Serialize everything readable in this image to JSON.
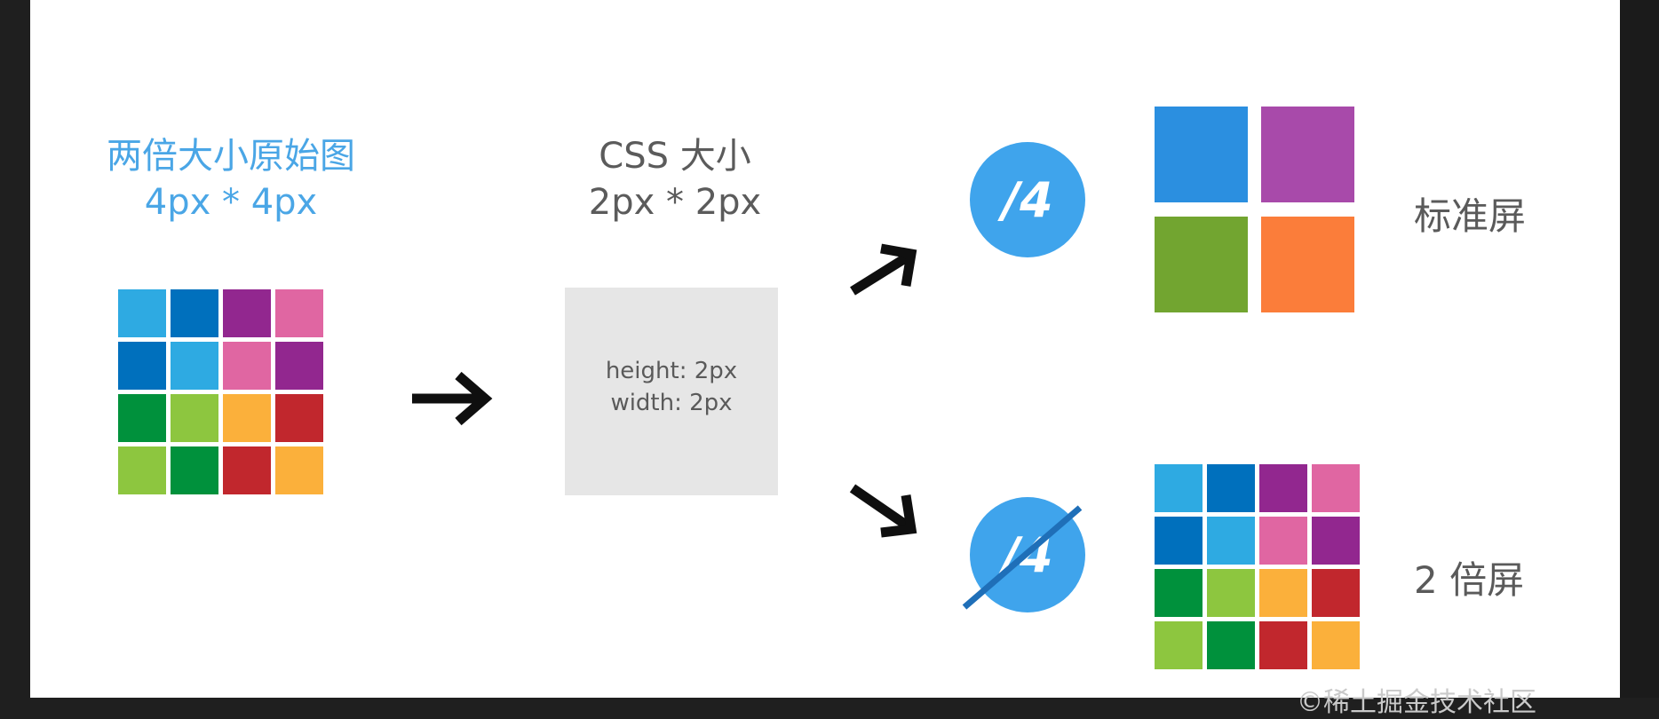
{
  "original": {
    "title": "两倍大小原始图",
    "size": "4px * 4px",
    "grid_colors": [
      "#2eaae2",
      "#0070bd",
      "#92278f",
      "#e066a2",
      "#0070bd",
      "#2eaae2",
      "#e066a2",
      "#92278f",
      "#00913c",
      "#8dc63f",
      "#fbb03b",
      "#c1272d",
      "#8dc63f",
      "#00913c",
      "#c1272d",
      "#fbb03b"
    ]
  },
  "css": {
    "title": "CSS 大小",
    "size": "2px * 2px",
    "height_text": "height: 2px",
    "width_text": "width: 2px"
  },
  "standard": {
    "badge": "/4",
    "label": "标准屏",
    "grid_colors": [
      "#2b8fe0",
      "#a84aaa",
      "#72a530",
      "#fb7d3a"
    ]
  },
  "retina": {
    "badge": "/4",
    "label": "2 倍屏",
    "strike_color": "#1f6fb8",
    "grid_colors": [
      "#2eaae2",
      "#0070bd",
      "#92278f",
      "#e066a2",
      "#0070bd",
      "#2eaae2",
      "#e066a2",
      "#92278f",
      "#00913c",
      "#8dc63f",
      "#fbb03b",
      "#c1272d",
      "#8dc63f",
      "#00913c",
      "#c1272d",
      "#fbb03b"
    ]
  },
  "watermark": "©稀土掘金技术社区",
  "colors": {
    "accent_blue": "#3fa4ec",
    "title_blue": "#4aa6e6",
    "arrow": "#0f0f0f"
  }
}
